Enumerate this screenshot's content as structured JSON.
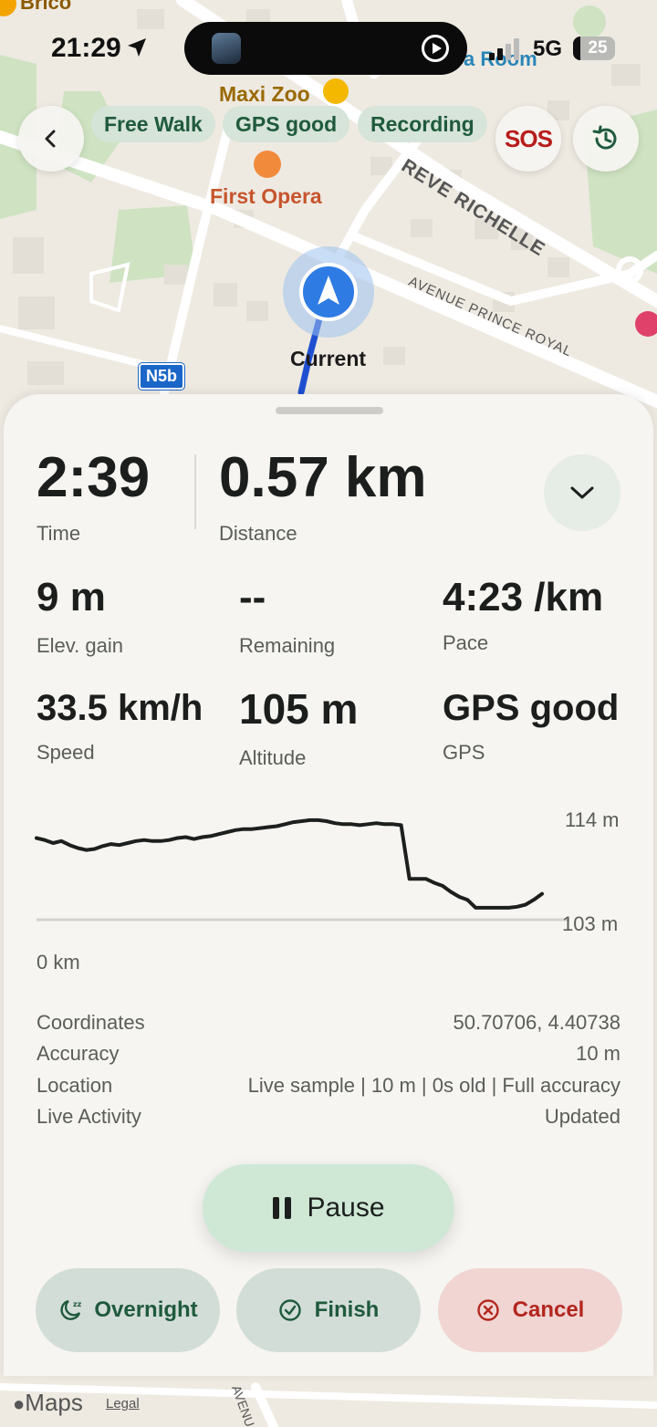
{
  "status_bar": {
    "time": "21:29",
    "network": "5G",
    "battery": "25"
  },
  "map": {
    "labels": {
      "brico": "Brico",
      "room": "a Room",
      "maxi_zoo": "Maxi Zoo",
      "first_opera": "First Opera",
      "street_richelle": "REVE RICHELLE",
      "avenue_prince": "AVENUE PRINCE ROYAL",
      "current": "Current",
      "route_badge": "N5b",
      "avenue_bottom": "AVENU"
    },
    "chips": [
      "Free Walk",
      "GPS good",
      "Recording"
    ],
    "sos_label": "SOS"
  },
  "stats": {
    "time": {
      "value": "2:39",
      "label": "Time"
    },
    "distance": {
      "value": "0.57 km",
      "label": "Distance"
    },
    "elev_gain": {
      "value": "9 m",
      "label": "Elev. gain"
    },
    "remaining": {
      "value": "--",
      "label": "Remaining"
    },
    "pace": {
      "value": "4:23 /km",
      "label": "Pace"
    },
    "speed": {
      "value": "33.5 km/h",
      "label": "Speed"
    },
    "altitude": {
      "value": "105 m",
      "label": "Altitude"
    },
    "gps": {
      "value": "GPS good",
      "label": "GPS"
    }
  },
  "chart_data": {
    "type": "line",
    "series": [
      {
        "values": [
          111.2,
          111.0,
          110.7,
          110.9,
          110.5,
          110.2,
          110.0,
          110.1,
          110.4,
          110.6,
          110.5,
          110.7,
          110.9,
          111.0,
          110.9,
          110.9,
          111.0,
          111.2,
          111.3,
          111.1,
          111.3,
          111.4,
          111.6,
          111.8,
          112.0,
          112.1,
          112.1,
          112.2,
          112.3,
          112.4,
          112.6,
          112.8,
          112.9,
          113.0,
          113.0,
          112.9,
          112.7,
          112.6,
          112.6,
          112.5,
          112.6,
          112.7,
          112.6,
          112.6,
          112.5,
          107.1,
          107.1,
          107.1,
          106.7,
          106.4,
          105.8,
          105.3,
          105.0,
          104.2,
          104.2,
          104.2,
          104.2,
          104.2,
          104.3,
          104.5,
          105.0,
          105.6
        ]
      }
    ],
    "x_label_start": "0 km",
    "y_max_label": "114 m",
    "y_min_label": "103 m",
    "ylim": [
      103,
      114
    ]
  },
  "details": [
    {
      "label": "Coordinates",
      "value": "50.70706, 4.40738"
    },
    {
      "label": "Accuracy",
      "value": "10 m"
    },
    {
      "label": "Location",
      "value": "Live sample | 10 m | 0s old | Full accuracy"
    },
    {
      "label": "Live Activity",
      "value": "Updated"
    }
  ],
  "buttons": {
    "pause": "Pause",
    "overnight": "Overnight",
    "finish": "Finish",
    "cancel": "Cancel"
  },
  "footer": {
    "maps": "Maps",
    "legal": "Legal"
  },
  "colors": {
    "accent_green": "#1f5a3c",
    "pause_bg": "#cfe8d6",
    "cancel_bg": "#f0d5d3",
    "cancel_fg": "#b3261e",
    "route_blue": "#1f4fd1"
  }
}
